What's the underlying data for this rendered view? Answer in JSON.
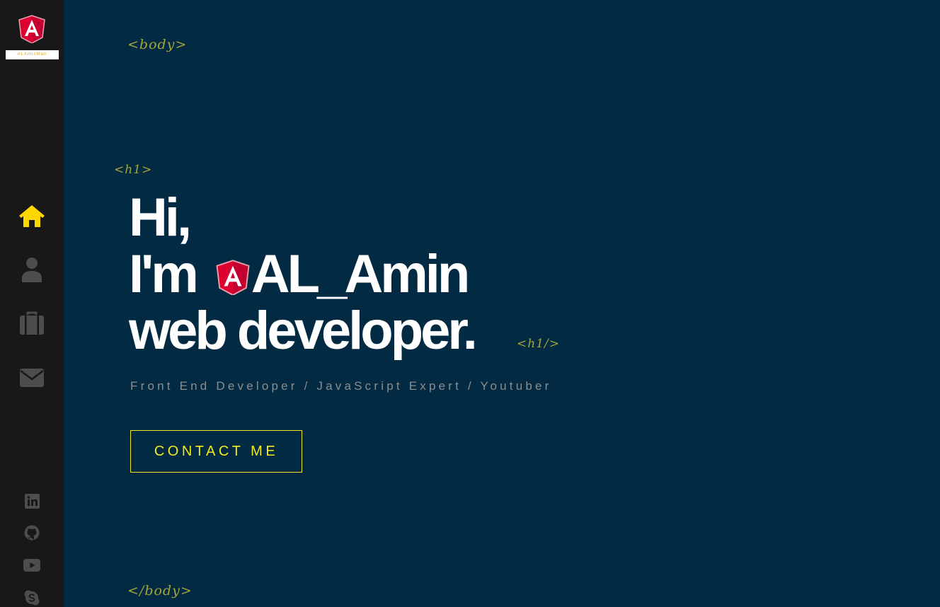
{
  "brand": {
    "logo_letter": "A",
    "logo_caption": "ALAminMan"
  },
  "sidebar": {
    "nav": [
      {
        "name": "home",
        "icon": "home-icon",
        "active": true
      },
      {
        "name": "about",
        "icon": "user-icon",
        "active": false
      },
      {
        "name": "portfolio",
        "icon": "briefcase-icon",
        "active": false
      },
      {
        "name": "contact",
        "icon": "envelope-icon",
        "active": false
      }
    ],
    "social": [
      "linkedin-icon",
      "github-icon",
      "youtube-icon",
      "skype-icon"
    ]
  },
  "tags": {
    "body_open": "<body>",
    "h1_open": "<h1>",
    "h1_close": "<h1/>",
    "body_close": "</body>"
  },
  "hero": {
    "line1": "Hi,",
    "line2_prefix": "I'm",
    "line2_name": "AL_Amin",
    "line3": "web developer.",
    "subtitle": "Front End Developer / JavaScript Expert / Youtuber",
    "cta_label": "CONTACT ME"
  },
  "colors": {
    "background": "#022a43",
    "sidebar": "#181818",
    "accent": "#ffd700",
    "tag": "#a5a53a",
    "angular_red": "#dd0031"
  }
}
